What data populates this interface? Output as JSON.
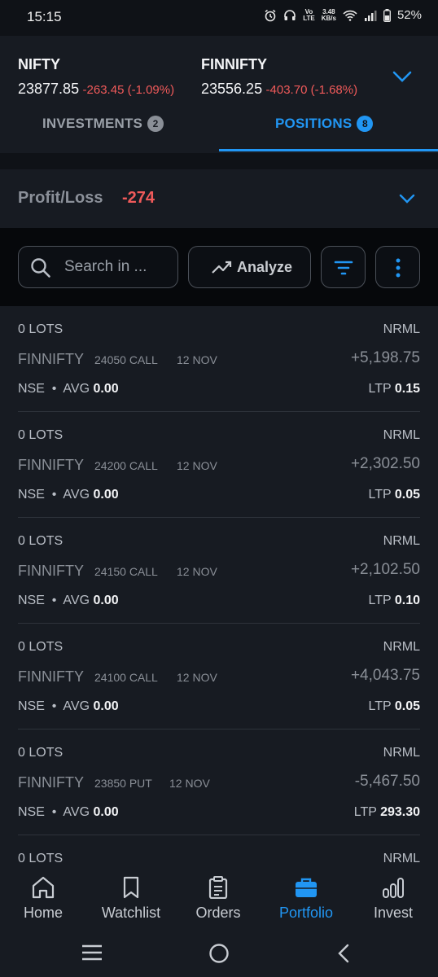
{
  "status": {
    "time": "15:15",
    "net_speed_top": "3.48",
    "net_speed_bottom": "KB/s",
    "volte_top": "Vo",
    "volte_bottom": "LTE",
    "battery": "52%"
  },
  "indices": [
    {
      "name": "NIFTY",
      "value": "23877.85",
      "change": "-263.45 (-1.09%)"
    },
    {
      "name": "FINNIFTY",
      "value": "23556.25",
      "change": "-403.70 (-1.68%)"
    }
  ],
  "tabs": [
    {
      "label": "INVESTMENTS",
      "count": "2"
    },
    {
      "label": "POSITIONS",
      "count": "8"
    }
  ],
  "summary": {
    "label": "Profit/Loss",
    "value": "-274"
  },
  "toolbar": {
    "search_placeholder": "Search in ...",
    "analyze_label": "Analyze"
  },
  "positions": [
    {
      "lots": "0 LOTS",
      "product": "NRML",
      "symbol": "FINNIFTY",
      "strike": "24050 CALL",
      "expiry": "12 NOV",
      "pnl": "+5,198.75",
      "exchange": "NSE",
      "avg_label": "AVG",
      "avg": "0.00",
      "ltp_label": "LTP",
      "ltp": "0.15"
    },
    {
      "lots": "0 LOTS",
      "product": "NRML",
      "symbol": "FINNIFTY",
      "strike": "24200 CALL",
      "expiry": "12 NOV",
      "pnl": "+2,302.50",
      "exchange": "NSE",
      "avg_label": "AVG",
      "avg": "0.00",
      "ltp_label": "LTP",
      "ltp": "0.05"
    },
    {
      "lots": "0 LOTS",
      "product": "NRML",
      "symbol": "FINNIFTY",
      "strike": "24150 CALL",
      "expiry": "12 NOV",
      "pnl": "+2,102.50",
      "exchange": "NSE",
      "avg_label": "AVG",
      "avg": "0.00",
      "ltp_label": "LTP",
      "ltp": "0.10"
    },
    {
      "lots": "0 LOTS",
      "product": "NRML",
      "symbol": "FINNIFTY",
      "strike": "24100 CALL",
      "expiry": "12 NOV",
      "pnl": "+4,043.75",
      "exchange": "NSE",
      "avg_label": "AVG",
      "avg": "0.00",
      "ltp_label": "LTP",
      "ltp": "0.05"
    },
    {
      "lots": "0 LOTS",
      "product": "NRML",
      "symbol": "FINNIFTY",
      "strike": "23850 PUT",
      "expiry": "12 NOV",
      "pnl": "-5,467.50",
      "exchange": "NSE",
      "avg_label": "AVG",
      "avg": "0.00",
      "ltp_label": "LTP",
      "ltp": "293.30"
    },
    {
      "lots": "0 LOTS",
      "product": "NRML"
    }
  ],
  "bottom_nav": [
    {
      "label": "Home",
      "icon": "home-icon"
    },
    {
      "label": "Watchlist",
      "icon": "bookmark-icon"
    },
    {
      "label": "Orders",
      "icon": "clipboard-icon"
    },
    {
      "label": "Portfolio",
      "icon": "briefcase-icon",
      "active": true
    },
    {
      "label": "Invest",
      "icon": "bar-chart-icon"
    }
  ],
  "colors": {
    "accent": "#2196f3",
    "loss": "#f05a5a",
    "background": "#0f1217",
    "panel": "#171b22"
  }
}
